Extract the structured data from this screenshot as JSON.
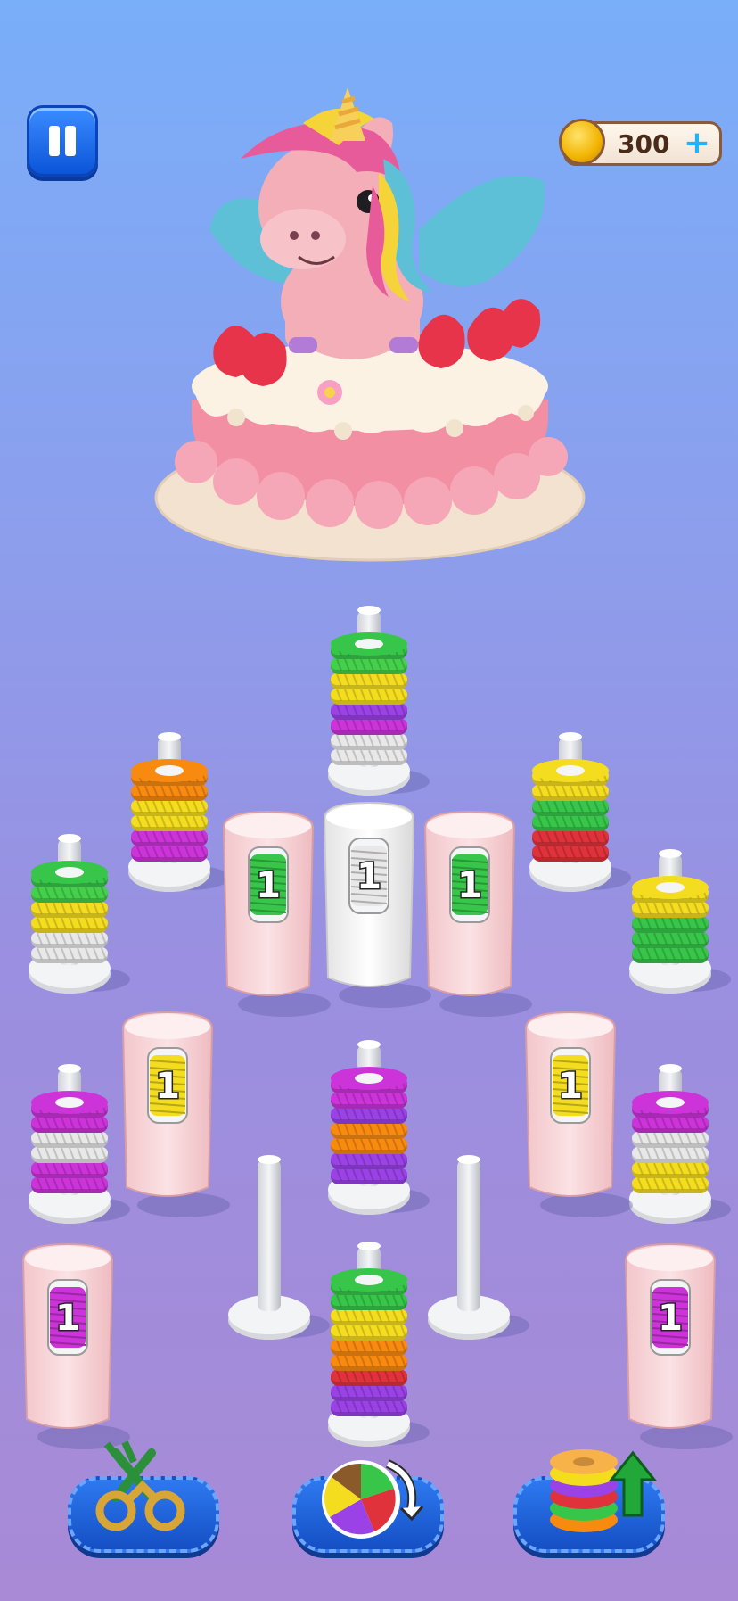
{
  "hud": {
    "pause_icon": "pause-icon",
    "coins": "300",
    "coins_plus": "+",
    "coin_icon": "coin-icon"
  },
  "palette": {
    "green": "#37c64a",
    "lime": "#45d04b",
    "yellow": "#f4dd1f",
    "purple": "#9a42e6",
    "magenta": "#cc34d9",
    "white": "#e8e8e8",
    "orange": "#f88a10",
    "red": "#e0323a",
    "pink_bin": "#f7d4d6",
    "white_bin": "#f3f3f3"
  },
  "target_image": "crochet-unicorn-cake",
  "bins": [
    {
      "color": "pink",
      "spool": "green",
      "count": "1"
    },
    {
      "color": "white",
      "spool": "white",
      "count": "1"
    },
    {
      "color": "pink",
      "spool": "green",
      "count": "1"
    },
    {
      "color": "pink",
      "spool": "yellow",
      "count": "1"
    },
    {
      "color": "pink",
      "spool": "yellow",
      "count": "1"
    },
    {
      "color": "pink",
      "spool": "magenta",
      "count": "1"
    },
    {
      "color": "pink",
      "spool": "magenta",
      "count": "1"
    }
  ],
  "pegs": [
    {
      "rings": [
        "white",
        "white",
        "magenta",
        "purple",
        "yellow",
        "yellow",
        "lime",
        "green"
      ]
    },
    {
      "rings": [
        "magenta",
        "magenta",
        "yellow",
        "yellow",
        "orange",
        "orange"
      ]
    },
    {
      "rings": [
        "red",
        "red",
        "green",
        "green",
        "yellow",
        "yellow"
      ]
    },
    {
      "rings": [
        "white",
        "white",
        "yellow",
        "yellow",
        "lime",
        "green"
      ]
    },
    {
      "rings": [
        "green",
        "green",
        "green",
        "yellow",
        "yellow"
      ]
    },
    {
      "rings": [
        "purple",
        "purple",
        "orange",
        "orange",
        "purple",
        "magenta",
        "magenta"
      ]
    },
    {
      "rings": [
        "magenta",
        "magenta",
        "white",
        "white",
        "magenta",
        "magenta"
      ]
    },
    {
      "rings": [
        "yellow",
        "yellow",
        "white",
        "white",
        "magenta",
        "magenta"
      ]
    },
    {
      "rings": [
        "purple",
        "purple",
        "red",
        "orange",
        "orange",
        "yellow",
        "yellow",
        "green",
        "green"
      ]
    },
    {
      "rings": []
    },
    {
      "rings": []
    }
  ],
  "tools": [
    {
      "name": "scissors",
      "icon": "scissors-icon"
    },
    {
      "name": "yarn-shuffle",
      "icon": "yarn-shuffle-icon"
    },
    {
      "name": "ring-boost",
      "icon": "ring-stack-up-icon"
    }
  ]
}
